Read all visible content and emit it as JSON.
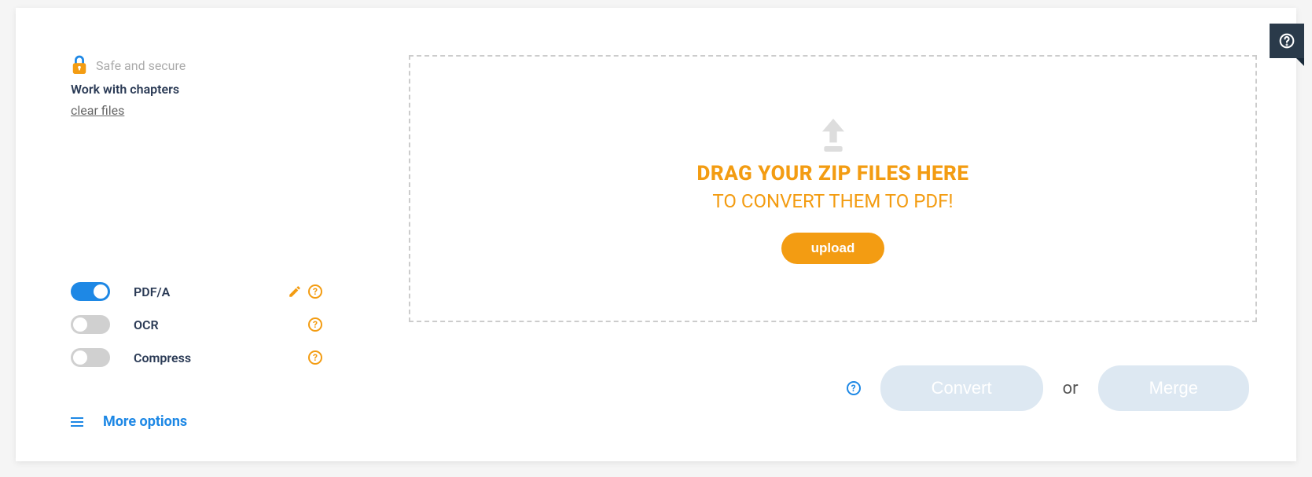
{
  "header": {
    "safe_label": "Safe and secure",
    "chapters_label": "Work with chapters",
    "clear_files_label": "clear files"
  },
  "toggles": {
    "pdfa": {
      "label": "PDF/A",
      "on": true,
      "has_edit": true
    },
    "ocr": {
      "label": "OCR",
      "on": false,
      "has_edit": false
    },
    "compress": {
      "label": "Compress",
      "on": false,
      "has_edit": false
    }
  },
  "more_options_label": "More options",
  "dropzone": {
    "title": "DRAG YOUR ZIP FILES HERE",
    "subtitle": "TO CONVERT THEM TO PDF!",
    "upload_label": "upload"
  },
  "actions": {
    "convert_label": "Convert",
    "or_label": "or",
    "merge_label": "Merge"
  }
}
